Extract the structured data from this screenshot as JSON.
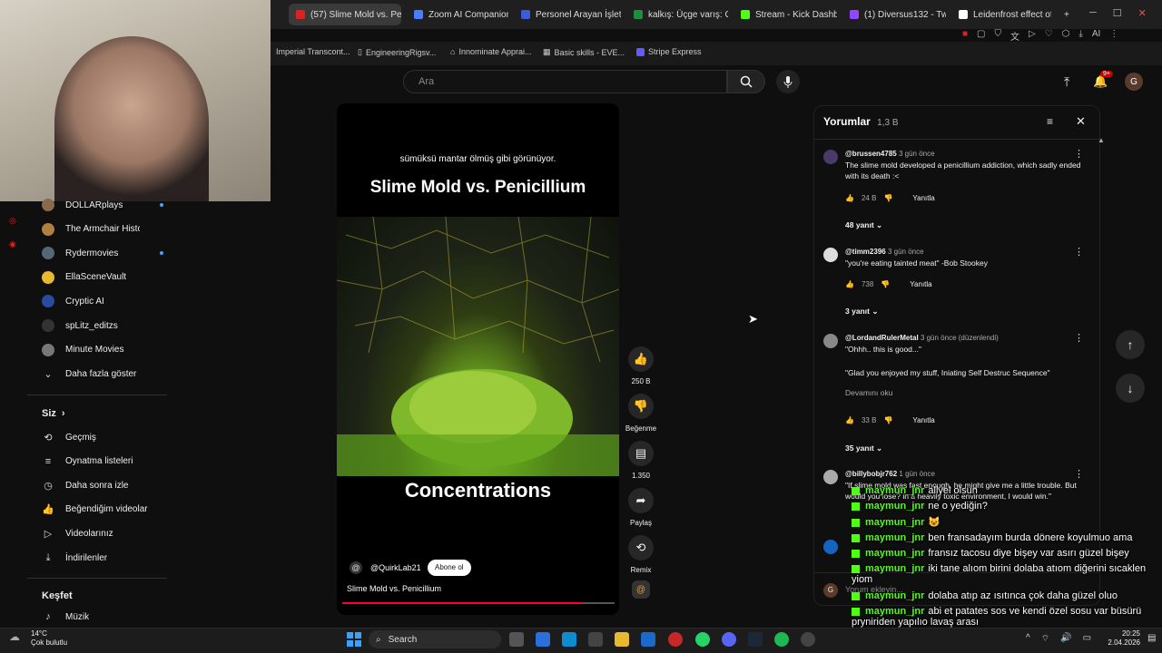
{
  "tabs": [
    {
      "label": "(57) Slime Mold vs. Pe",
      "color": "#e02020"
    },
    {
      "label": "Zoom AI Companion",
      "color": "#4a7cff"
    },
    {
      "label": "Personel Arayan İşletme",
      "color": "#3b5bdb"
    },
    {
      "label": "kalkış: Üçge varış: Göld",
      "color": "#1e8e3e"
    },
    {
      "label": "Stream - Kick Dashboar",
      "color": "#53fc18"
    },
    {
      "label": "(1) Diversus132 - Twitch",
      "color": "#9146ff"
    },
    {
      "label": "Leidenfrost effect of a s",
      "color": "#ffffff"
    }
  ],
  "bookmarks": [
    "Imperial Transcont...",
    "EngineeringRigsv...",
    "Innominate Apprai...",
    "Basic skills - EVE...",
    "Stripe Express"
  ],
  "search": {
    "placeholder": "Ara"
  },
  "header": {
    "notif_count": "9+",
    "avatar": "G"
  },
  "sidebar": {
    "subs": [
      {
        "label": "DOLLARplays",
        "dot": true,
        "color": "#8a6a4a"
      },
      {
        "label": "The Armchair Histo...",
        "dot": false,
        "color": "#b08040"
      },
      {
        "label": "Rydermovies",
        "dot": true,
        "color": "#556677"
      },
      {
        "label": "EllaSceneVault",
        "dot": false,
        "color": "#e8b830"
      },
      {
        "label": "Cryptic AI",
        "dot": false,
        "color": "#2a4aa0"
      },
      {
        "label": "spLitz_editzs",
        "dot": false,
        "color": "#333"
      },
      {
        "label": "Minute Movies",
        "dot": false,
        "color": "#777"
      }
    ],
    "show_more": "Daha fazla göster",
    "you_title": "Siz",
    "you_items": [
      "Geçmiş",
      "Oynatma listeleri",
      "Daha sonra izle",
      "Beğendiğim videolar",
      "Videolarınız",
      "İndirilenler"
    ],
    "explore_title": "Keşfet",
    "explore_items": [
      "Müzik"
    ]
  },
  "video": {
    "caption": "sümüksü mantar ölmüş gibi görünüyor.",
    "title_overlay": "Slime Mold vs. Penicillium",
    "bottom_overlay": "Concentrations",
    "channel": "@QuirkLab21",
    "subscribe": "Abone ol",
    "title": "Slime Mold vs. Penicillium",
    "progress": 0.88
  },
  "actions": {
    "likes": "250 B",
    "dislike": "Beğenme",
    "comments": "1.350",
    "share": "Paylaş",
    "remix": "Remix"
  },
  "comments_panel": {
    "title": "Yorumlar",
    "count": "1,3 B",
    "input_placeholder": "Yorum ekleyin...",
    "items": [
      {
        "user": "@brussen4785",
        "time": "3 gün önce",
        "text": "The slime mold developed a penicillium addiction, which sadly ended with its death :<",
        "likes": "24 B",
        "reply": "Yanıtla",
        "replies": "48 yanıt"
      },
      {
        "user": "@timm2396",
        "time": "3 gün önce",
        "text": "\"you're eating tainted meat\" -Bob Stookey",
        "likes": "738",
        "reply": "Yanıtla",
        "replies": "3 yanıt"
      },
      {
        "user": "@LordandRulerMetal",
        "time": "3 gün önce (düzenlendi)",
        "text": "\"Ohhh.. this is good...\"",
        "text2": "\"Glad you enjoyed my stuff, Iniating Self Destruc Sequence\"",
        "more": "Devamını oku",
        "likes": "33 B",
        "reply": "Yanıtla",
        "replies": "35 yanıt"
      },
      {
        "user": "@billybobjr762",
        "time": "1 gün önce",
        "text": "\"If slime mold was fast enough, he might give me a little trouble. But would you lose? in a heavily toxic environment, I would win.\""
      }
    ]
  },
  "chat": [
    {
      "user": "maymun_jnr",
      "msg": "allyel olsun"
    },
    {
      "user": "maymun_jnr",
      "msg": "ne o yediğin?"
    },
    {
      "user": "maymun_jnr",
      "msg": "😺"
    },
    {
      "user": "maymun_jnr",
      "msg": "ben fransadayım burda dönere koyulmuo ama"
    },
    {
      "user": "maymun_jnr",
      "msg": "fransız tacosu diye bişey var asırı güzel bişey"
    },
    {
      "user": "maymun_jnr",
      "msg": "iki tane alıom birini dolaba atıom diğerini sıcaklen yiom"
    },
    {
      "user": "maymun_jnr",
      "msg": "dolaba atıp az ısıtınca çok daha güzel oluo"
    },
    {
      "user": "maymun_jnr",
      "msg": "abi et patates sos ve kendi özel sosu var büsürü pryniriden yapılıo lavaş arası"
    },
    {
      "user": "maymun_jnr",
      "msg": "😺"
    }
  ],
  "taskbar": {
    "weather_temp": "14°C",
    "weather_desc": "Çok bulutlu",
    "search": "Search",
    "time": "20:25",
    "date": "2.04.2026"
  }
}
